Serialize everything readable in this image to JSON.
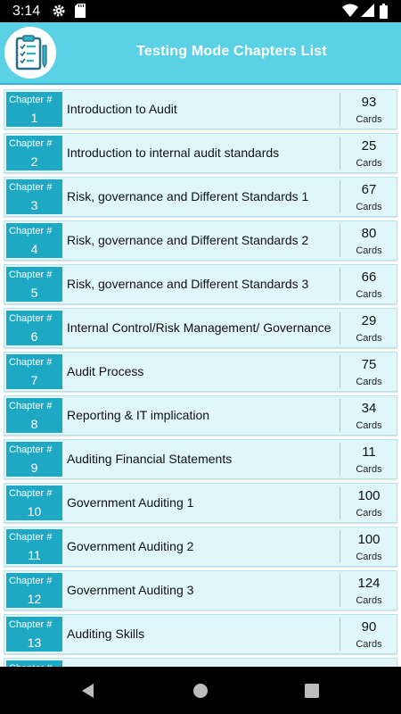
{
  "status_bar": {
    "time": "3:14",
    "icons": [
      "gear-icon",
      "sd-card-icon",
      "wifi-icon",
      "signal-icon",
      "battery-icon"
    ]
  },
  "header": {
    "title": "Testing Mode Chapters List",
    "logo_icon": "checklist-clipboard-icon"
  },
  "chapter_label": "Chapter #",
  "cards_label": "Cards",
  "chapters": [
    {
      "number": "1",
      "title": "Introduction to Audit",
      "cards": "93"
    },
    {
      "number": "2",
      "title": "Introduction to  internal audit standards",
      "cards": "25"
    },
    {
      "number": "3",
      "title": "Risk, governance and Different Standards 1",
      "cards": "67"
    },
    {
      "number": "4",
      "title": "Risk, governance and Different Standards 2",
      "cards": "80"
    },
    {
      "number": "5",
      "title": "Risk, governance and Different Standards 3",
      "cards": "66"
    },
    {
      "number": "6",
      "title": "Internal Control/Risk Management/ Governance",
      "cards": "29"
    },
    {
      "number": "7",
      "title": "Audit Process",
      "cards": "75"
    },
    {
      "number": "8",
      "title": "Reporting & IT implication",
      "cards": "34"
    },
    {
      "number": "9",
      "title": "Auditing Financial Statements",
      "cards": "11"
    },
    {
      "number": "10",
      "title": "Government Auditing 1",
      "cards": "100"
    },
    {
      "number": "11",
      "title": "Government Auditing 2",
      "cards": "100"
    },
    {
      "number": "12",
      "title": "Government Auditing 3",
      "cards": "124"
    },
    {
      "number": "13",
      "title": "Auditing Skills",
      "cards": "90"
    }
  ],
  "nav_bar": {
    "icons": [
      "back-icon",
      "home-icon",
      "recents-icon"
    ]
  }
}
